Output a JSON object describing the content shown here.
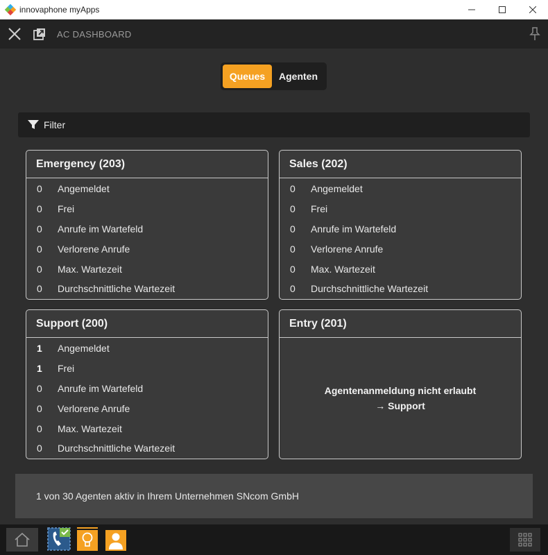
{
  "window": {
    "title": "innovaphone myApps"
  },
  "app": {
    "title": "AC DASHBOARD"
  },
  "tabs": [
    {
      "label": "Queues",
      "active": true
    },
    {
      "label": "Agenten",
      "active": false
    }
  ],
  "filter": {
    "label": "Filter"
  },
  "queues": [
    {
      "title": "Emergency (203)",
      "rows": [
        {
          "value": "0",
          "label": "Angemeldet"
        },
        {
          "value": "0",
          "label": "Frei"
        },
        {
          "value": "0",
          "label": "Anrufe im Wartefeld"
        },
        {
          "value": "0",
          "label": "Verlorene Anrufe"
        },
        {
          "value": "0",
          "label": "Max. Wartezeit"
        },
        {
          "value": "0",
          "label": "Durchschnittliche Wartezeit"
        }
      ]
    },
    {
      "title": "Sales (202)",
      "rows": [
        {
          "value": "0",
          "label": "Angemeldet"
        },
        {
          "value": "0",
          "label": "Frei"
        },
        {
          "value": "0",
          "label": "Anrufe im Wartefeld"
        },
        {
          "value": "0",
          "label": "Verlorene Anrufe"
        },
        {
          "value": "0",
          "label": "Max. Wartezeit"
        },
        {
          "value": "0",
          "label": "Durchschnittliche Wartezeit"
        }
      ]
    },
    {
      "title": "Support (200)",
      "rows": [
        {
          "value": "1",
          "label": "Angemeldet"
        },
        {
          "value": "1",
          "label": "Frei"
        },
        {
          "value": "0",
          "label": "Anrufe im Wartefeld"
        },
        {
          "value": "0",
          "label": "Verlorene Anrufe"
        },
        {
          "value": "0",
          "label": "Max. Wartezeit"
        },
        {
          "value": "0",
          "label": "Durchschnittliche Wartezeit"
        }
      ]
    },
    {
      "title": "Entry (201)",
      "message_line1": "Agentenanmeldung nicht erlaubt",
      "message_line2": "→ Support"
    }
  ],
  "footer": {
    "status": "1 von 30 Agenten aktiv in Ihrem Unternehmen SNcom GmbH"
  },
  "colors": {
    "accent": "#f5a122",
    "background": "#2e2e2e",
    "header": "#232323",
    "card_border": "#c9c9c9"
  },
  "icons": [
    "close-icon",
    "popout-icon",
    "pin-icon",
    "filter-icon",
    "home-icon",
    "phone-app-icon",
    "lightbulb-app-icon",
    "contacts-app-icon",
    "app-grid-icon"
  ]
}
